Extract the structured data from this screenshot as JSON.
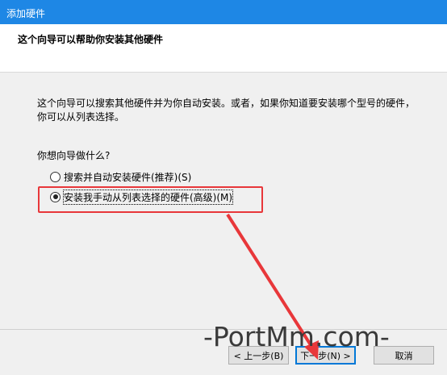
{
  "window": {
    "title": "添加硬件"
  },
  "header": {
    "title": "这个向导可以帮助你安装其他硬件"
  },
  "main": {
    "description": "这个向导可以搜索其他硬件并为你自动安装。或者，如果你知道要安装哪个型号的硬件，你可以从列表选择。",
    "question": "你想向导做什么?",
    "options": [
      {
        "label": "搜索并自动安装硬件(推荐)(S)",
        "checked": false
      },
      {
        "label": "安装我手动从列表选择的硬件(高级)(M)",
        "checked": true
      }
    ]
  },
  "footer": {
    "back_label": "< 上一步(B)",
    "next_label": "下一步(N) >",
    "cancel_label": "取消"
  },
  "watermark": {
    "text": "-PortMm.com-"
  },
  "colors": {
    "titlebar": "#1e87e5",
    "annotation": "#e8373a",
    "default_button_border": "#0078d7"
  }
}
